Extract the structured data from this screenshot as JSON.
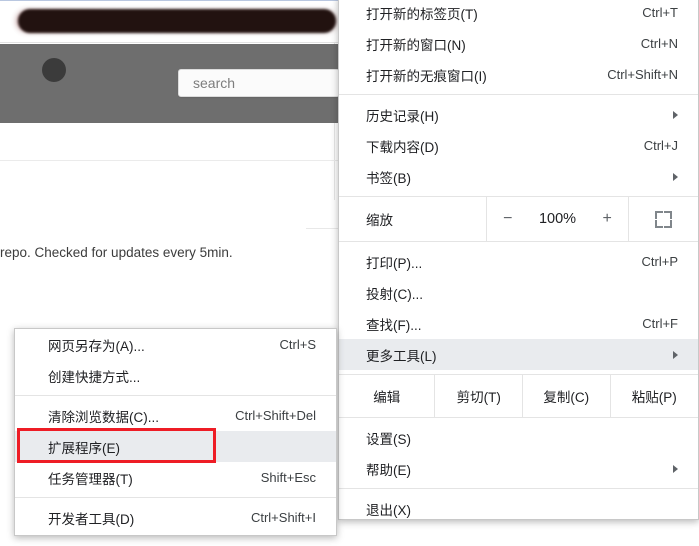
{
  "background_page": {
    "redacted_title_bar": "",
    "avatar": "user-avatar",
    "search": {
      "placeholder": "search",
      "value": ""
    },
    "body_text": "repo. Checked for updates every 5min."
  },
  "chrome_menu": {
    "groups": [
      {
        "items": [
          {
            "label": "打开新的标签页(T)",
            "accel": "Ctrl+T",
            "arrow": false
          },
          {
            "label": "打开新的窗口(N)",
            "accel": "Ctrl+N",
            "arrow": false
          },
          {
            "label": "打开新的无痕窗口(I)",
            "accel": "Ctrl+Shift+N",
            "arrow": false
          }
        ]
      },
      {
        "items": [
          {
            "label": "历史记录(H)",
            "accel": "",
            "arrow": true
          },
          {
            "label": "下载内容(D)",
            "accel": "Ctrl+J",
            "arrow": false
          },
          {
            "label": "书签(B)",
            "accel": "",
            "arrow": true
          }
        ]
      },
      {
        "items": [
          {
            "label": "打印(P)...",
            "accel": "Ctrl+P",
            "arrow": false
          },
          {
            "label": "投射(C)...",
            "accel": "",
            "arrow": false
          },
          {
            "label": "查找(F)...",
            "accel": "Ctrl+F",
            "arrow": false
          },
          {
            "label": "更多工具(L)",
            "accel": "",
            "arrow": true,
            "highlighted": true
          }
        ]
      },
      {
        "items": [
          {
            "label": "设置(S)",
            "accel": "",
            "arrow": false
          },
          {
            "label": "帮助(E)",
            "accel": "",
            "arrow": true
          }
        ]
      },
      {
        "items": [
          {
            "label": "退出(X)",
            "accel": "",
            "arrow": false
          }
        ]
      }
    ],
    "zoom_row": {
      "label": "缩放",
      "minus": "−",
      "value": "100%",
      "plus": "+",
      "fullscreen_icon": "fullscreen-icon"
    },
    "edit_row": {
      "label": "编辑",
      "cut": "剪切(T)",
      "copy": "复制(C)",
      "paste": "粘贴(P)"
    }
  },
  "tools_submenu": {
    "items": [
      {
        "label": "网页另存为(A)...",
        "accel": "Ctrl+S"
      },
      {
        "label": "创建快捷方式...",
        "accel": ""
      },
      {
        "label": "清除浏览数据(C)...",
        "accel": "Ctrl+Shift+Del"
      },
      {
        "label": "扩展程序(E)",
        "accel": "",
        "highlighted": true
      },
      {
        "label": "任务管理器(T)",
        "accel": "Shift+Esc"
      },
      {
        "label": "开发者工具(D)",
        "accel": "Ctrl+Shift+I"
      }
    ]
  },
  "annotation": {
    "highlight_color": "#ee1c25",
    "target": "扩展程序(E)"
  },
  "colors": {
    "menu_bg": "#ffffff",
    "menu_border": "#c8c8c8",
    "hover_bg": "#e9ebee",
    "page_band": "#6e6e6e",
    "text": "#202124"
  }
}
